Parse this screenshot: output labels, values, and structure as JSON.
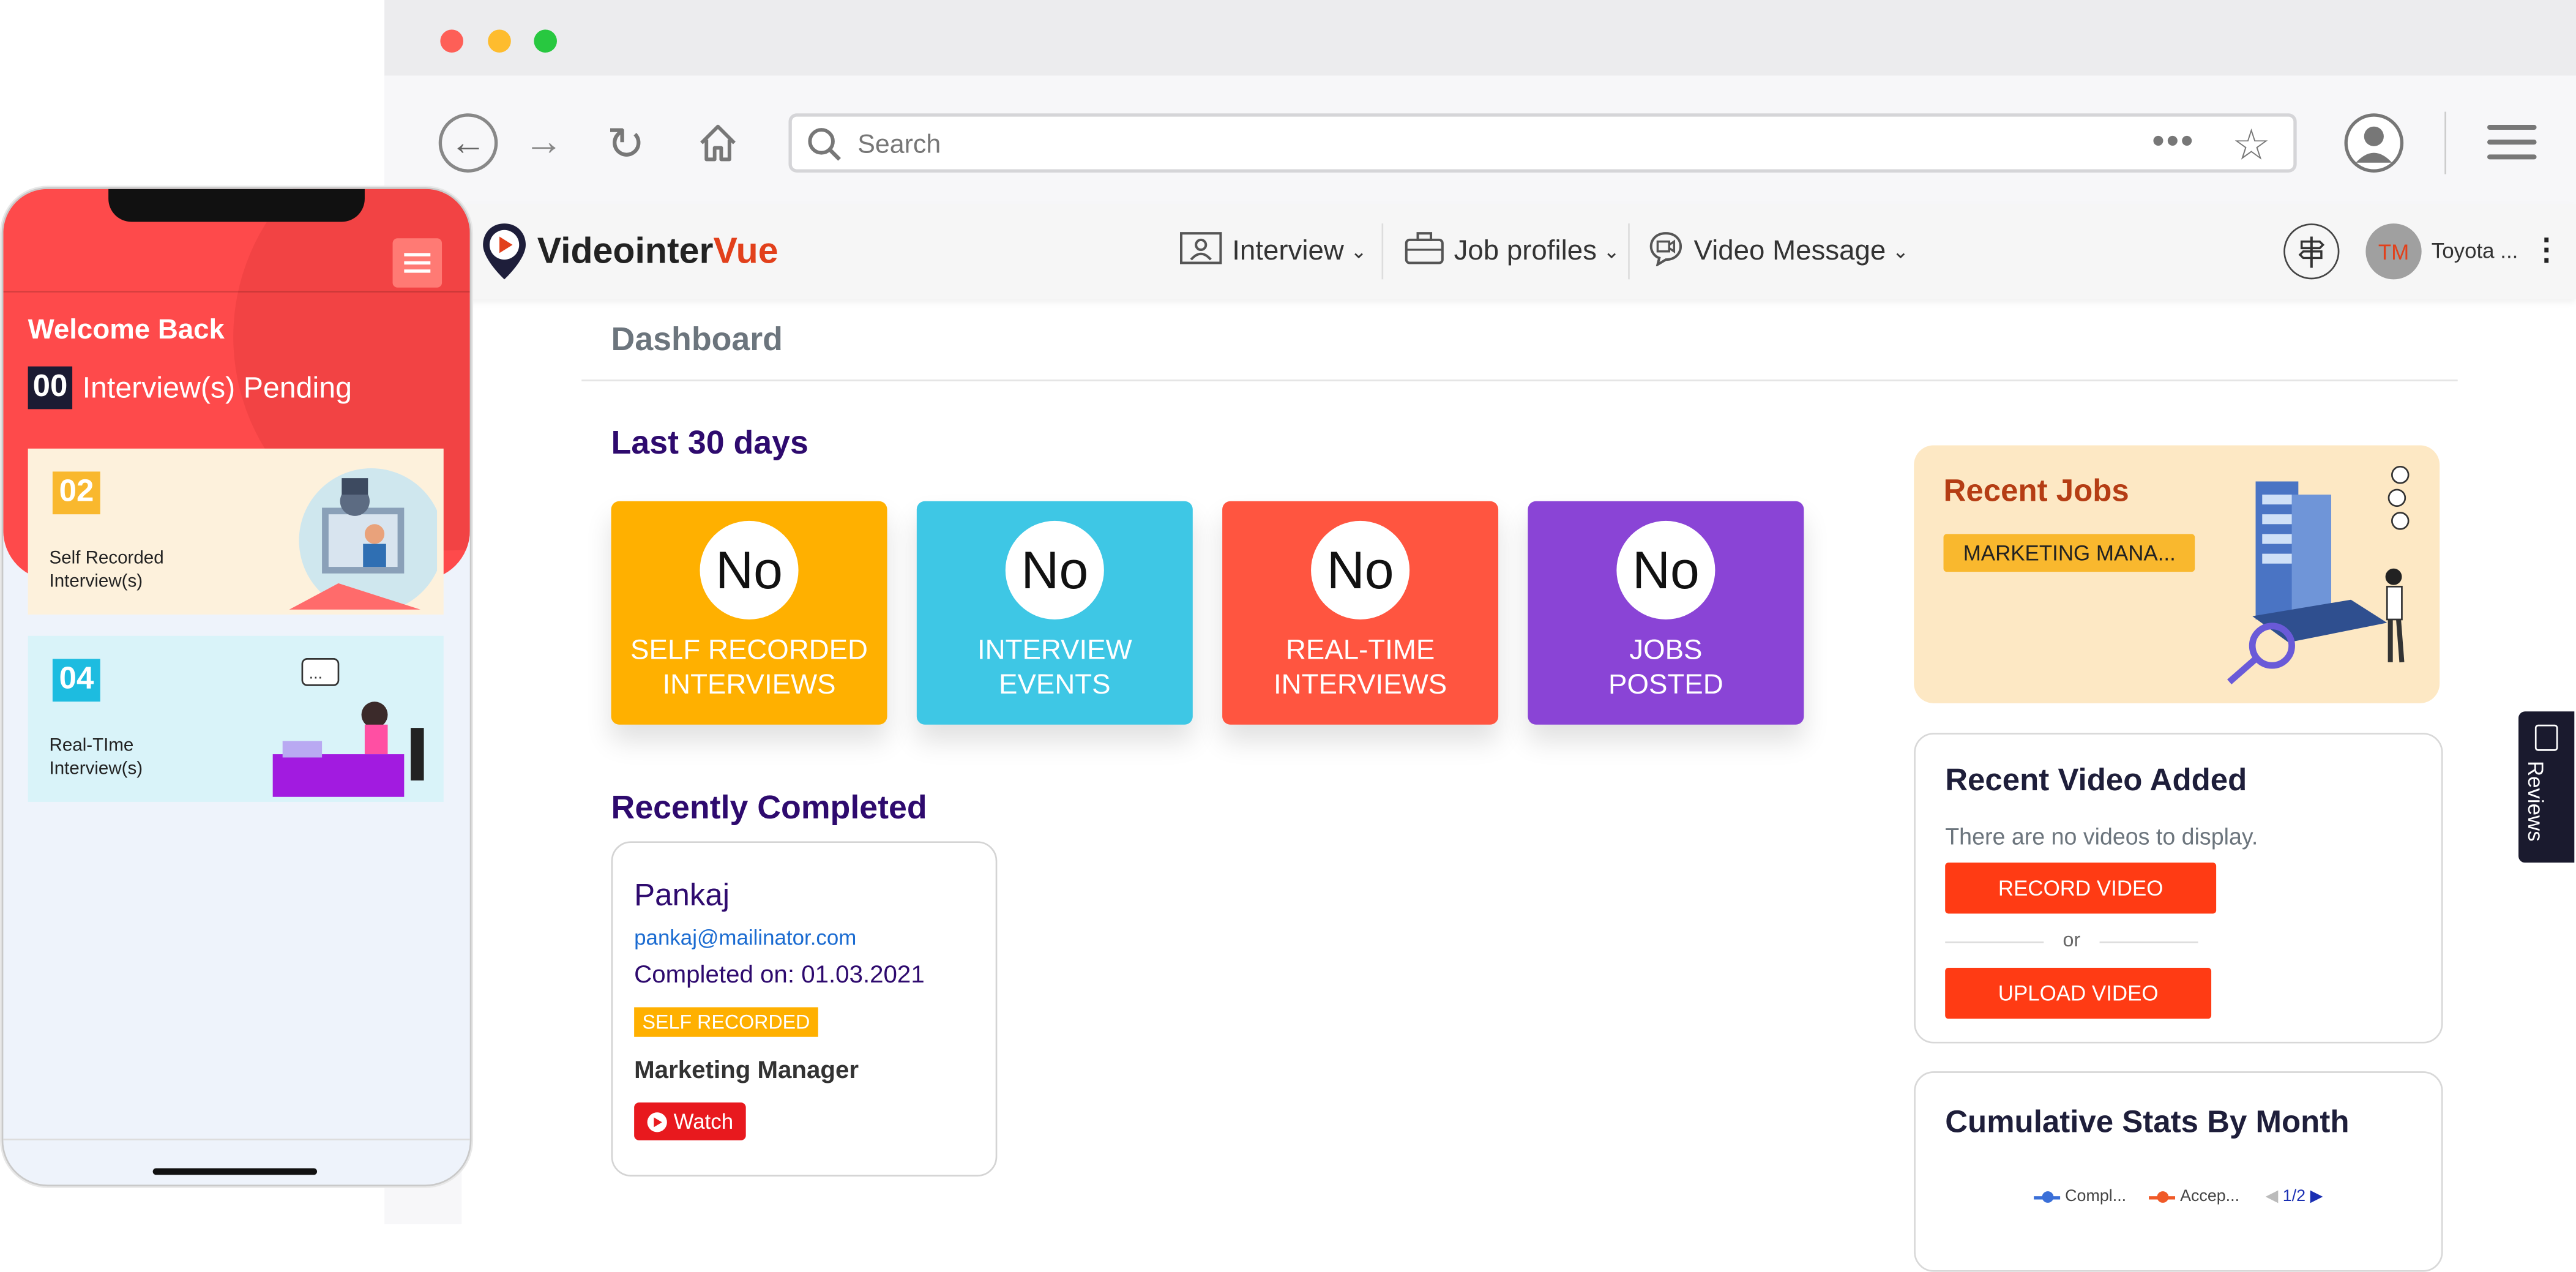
{
  "browser": {
    "search_placeholder": "Search",
    "menu_dots": "•••"
  },
  "app": {
    "logo_prefix": "Videointer",
    "logo_suffix": "Vue",
    "nav": {
      "interview": "Interview",
      "job_profiles": "Job profiles",
      "video_message": "Video Message"
    },
    "user": {
      "initials": "TM",
      "name": "Toyota ..."
    },
    "page_title": "Dashboard",
    "last_30_days": "Last 30 days",
    "stats_cards": [
      {
        "value": "No",
        "label_line1": "SELF RECORDED",
        "label_line2": "INTERVIEWS",
        "color": "#ffb000"
      },
      {
        "value": "No",
        "label_line1": "INTERVIEW",
        "label_line2": "EVENTS",
        "color": "#3ec7e5"
      },
      {
        "value": "No",
        "label_line1": "REAL-TIME",
        "label_line2": "INTERVIEWS",
        "color": "#ff5540"
      },
      {
        "value": "No",
        "label_line1": "JOBS",
        "label_line2": "POSTED",
        "color": "#8a44d6"
      }
    ],
    "recently_completed": {
      "title": "Recently Completed",
      "name": "Pankaj",
      "email": "pankaj@mailinator.com",
      "completed_on": "Completed on: 01.03.2021",
      "badge": "SELF RECORDED",
      "role": "Marketing Manager",
      "watch_label": "Watch"
    },
    "recent_jobs": {
      "title": "Recent Jobs",
      "job_tag": "MARKETING MANA..."
    },
    "recent_video": {
      "title": "Recent Video Added",
      "message": "There are no videos to display.",
      "record_label": "RECORD VIDEO",
      "or_label": "or",
      "upload_label": "UPLOAD VIDEO"
    },
    "cumulative_stats": {
      "title": "Cumulative Stats By Month",
      "legend": [
        {
          "name": "Compl...",
          "color": "#3a6fd8"
        },
        {
          "name": "Accep...",
          "color": "#f05a28"
        }
      ],
      "pager": "1/2"
    },
    "reviews_tab": "Reviews"
  },
  "phone": {
    "welcome": "Welcome Back",
    "pending_count": "00",
    "pending_label": "Interview(s) Pending",
    "cards": [
      {
        "count": "02",
        "label_line1": "Self Recorded",
        "label_line2": "Interview(s)"
      },
      {
        "count": "04",
        "label_line1": "Real-TIme",
        "label_line2": "Interview(s)"
      }
    ]
  },
  "colors": {
    "accent_red": "#ff3b14",
    "brand_purple": "#2e0a6e",
    "phone_red": "#fe4a4b"
  }
}
